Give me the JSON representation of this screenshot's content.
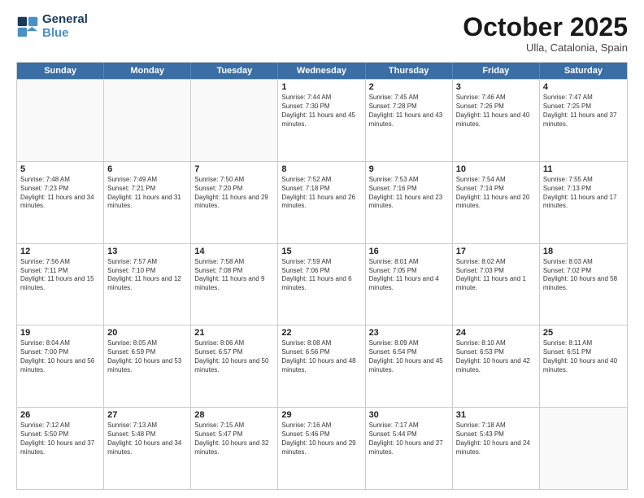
{
  "logo": {
    "line1": "General",
    "line2": "Blue"
  },
  "title": "October 2025",
  "subtitle": "Ulla, Catalonia, Spain",
  "header_days": [
    "Sunday",
    "Monday",
    "Tuesday",
    "Wednesday",
    "Thursday",
    "Friday",
    "Saturday"
  ],
  "rows": [
    [
      {
        "day": "",
        "text": ""
      },
      {
        "day": "",
        "text": ""
      },
      {
        "day": "",
        "text": ""
      },
      {
        "day": "1",
        "text": "Sunrise: 7:44 AM\nSunset: 7:30 PM\nDaylight: 11 hours and 45 minutes."
      },
      {
        "day": "2",
        "text": "Sunrise: 7:45 AM\nSunset: 7:28 PM\nDaylight: 11 hours and 43 minutes."
      },
      {
        "day": "3",
        "text": "Sunrise: 7:46 AM\nSunset: 7:26 PM\nDaylight: 11 hours and 40 minutes."
      },
      {
        "day": "4",
        "text": "Sunrise: 7:47 AM\nSunset: 7:25 PM\nDaylight: 11 hours and 37 minutes."
      }
    ],
    [
      {
        "day": "5",
        "text": "Sunrise: 7:48 AM\nSunset: 7:23 PM\nDaylight: 11 hours and 34 minutes."
      },
      {
        "day": "6",
        "text": "Sunrise: 7:49 AM\nSunset: 7:21 PM\nDaylight: 11 hours and 31 minutes."
      },
      {
        "day": "7",
        "text": "Sunrise: 7:50 AM\nSunset: 7:20 PM\nDaylight: 11 hours and 29 minutes."
      },
      {
        "day": "8",
        "text": "Sunrise: 7:52 AM\nSunset: 7:18 PM\nDaylight: 11 hours and 26 minutes."
      },
      {
        "day": "9",
        "text": "Sunrise: 7:53 AM\nSunset: 7:16 PM\nDaylight: 11 hours and 23 minutes."
      },
      {
        "day": "10",
        "text": "Sunrise: 7:54 AM\nSunset: 7:14 PM\nDaylight: 11 hours and 20 minutes."
      },
      {
        "day": "11",
        "text": "Sunrise: 7:55 AM\nSunset: 7:13 PM\nDaylight: 11 hours and 17 minutes."
      }
    ],
    [
      {
        "day": "12",
        "text": "Sunrise: 7:56 AM\nSunset: 7:11 PM\nDaylight: 11 hours and 15 minutes."
      },
      {
        "day": "13",
        "text": "Sunrise: 7:57 AM\nSunset: 7:10 PM\nDaylight: 11 hours and 12 minutes."
      },
      {
        "day": "14",
        "text": "Sunrise: 7:58 AM\nSunset: 7:08 PM\nDaylight: 11 hours and 9 minutes."
      },
      {
        "day": "15",
        "text": "Sunrise: 7:59 AM\nSunset: 7:06 PM\nDaylight: 11 hours and 6 minutes."
      },
      {
        "day": "16",
        "text": "Sunrise: 8:01 AM\nSunset: 7:05 PM\nDaylight: 11 hours and 4 minutes."
      },
      {
        "day": "17",
        "text": "Sunrise: 8:02 AM\nSunset: 7:03 PM\nDaylight: 11 hours and 1 minute."
      },
      {
        "day": "18",
        "text": "Sunrise: 8:03 AM\nSunset: 7:02 PM\nDaylight: 10 hours and 58 minutes."
      }
    ],
    [
      {
        "day": "19",
        "text": "Sunrise: 8:04 AM\nSunset: 7:00 PM\nDaylight: 10 hours and 56 minutes."
      },
      {
        "day": "20",
        "text": "Sunrise: 8:05 AM\nSunset: 6:59 PM\nDaylight: 10 hours and 53 minutes."
      },
      {
        "day": "21",
        "text": "Sunrise: 8:06 AM\nSunset: 6:57 PM\nDaylight: 10 hours and 50 minutes."
      },
      {
        "day": "22",
        "text": "Sunrise: 8:08 AM\nSunset: 6:56 PM\nDaylight: 10 hours and 48 minutes."
      },
      {
        "day": "23",
        "text": "Sunrise: 8:09 AM\nSunset: 6:54 PM\nDaylight: 10 hours and 45 minutes."
      },
      {
        "day": "24",
        "text": "Sunrise: 8:10 AM\nSunset: 6:53 PM\nDaylight: 10 hours and 42 minutes."
      },
      {
        "day": "25",
        "text": "Sunrise: 8:11 AM\nSunset: 6:51 PM\nDaylight: 10 hours and 40 minutes."
      }
    ],
    [
      {
        "day": "26",
        "text": "Sunrise: 7:12 AM\nSunset: 5:50 PM\nDaylight: 10 hours and 37 minutes."
      },
      {
        "day": "27",
        "text": "Sunrise: 7:13 AM\nSunset: 5:48 PM\nDaylight: 10 hours and 34 minutes."
      },
      {
        "day": "28",
        "text": "Sunrise: 7:15 AM\nSunset: 5:47 PM\nDaylight: 10 hours and 32 minutes."
      },
      {
        "day": "29",
        "text": "Sunrise: 7:16 AM\nSunset: 5:46 PM\nDaylight: 10 hours and 29 minutes."
      },
      {
        "day": "30",
        "text": "Sunrise: 7:17 AM\nSunset: 5:44 PM\nDaylight: 10 hours and 27 minutes."
      },
      {
        "day": "31",
        "text": "Sunrise: 7:18 AM\nSunset: 5:43 PM\nDaylight: 10 hours and 24 minutes."
      },
      {
        "day": "",
        "text": ""
      }
    ]
  ]
}
